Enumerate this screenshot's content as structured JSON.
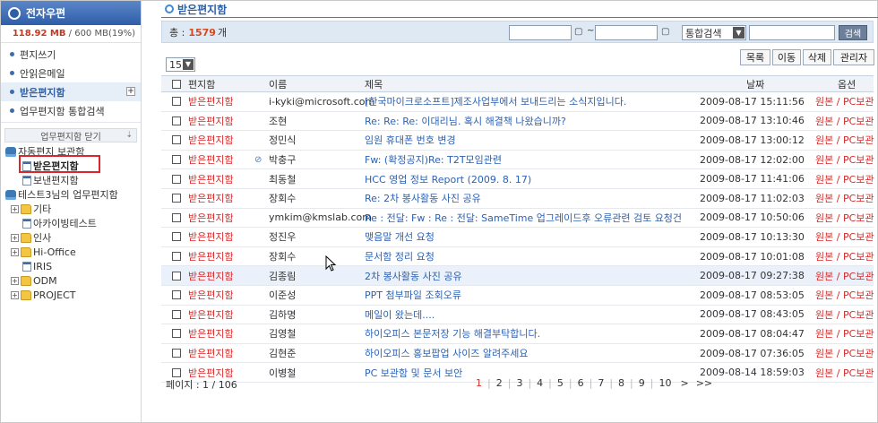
{
  "sidebar": {
    "title": "전자우편",
    "quota": {
      "used": "118.92 MB",
      "total": "/ 600 MB(19%)"
    },
    "menu": [
      {
        "label": "편지쓰기"
      },
      {
        "label": "안읽은메일"
      },
      {
        "label": "받은편지함",
        "plus": "+"
      },
      {
        "label": "업무편지함 통합검색"
      }
    ],
    "close_label": "업무편지함 닫기",
    "tree": {
      "g1": "자동편지 보관함",
      "g1_items": [
        "받은편지함",
        "보낸편지함"
      ],
      "g2": "테스트3님의 업무편지함",
      "g2_items": [
        "기타",
        "아카이빙테스트",
        "인사",
        "Hi-Office",
        "IRIS",
        "ODM",
        "PROJECT"
      ]
    }
  },
  "main": {
    "title": "받은편지함",
    "total_label": "총 :",
    "total_count": "1579",
    "total_unit": "개",
    "date_sep": "~",
    "search_type": "통합검색",
    "search_btn": "검색",
    "per_page": "15",
    "actions": [
      "목록",
      "이동",
      "삭제",
      "관리자"
    ],
    "columns": {
      "box": "편지함",
      "name": "이름",
      "subject": "제목",
      "date": "날짜",
      "option": "옵션"
    },
    "rows": [
      {
        "box": "받은편지함",
        "name": "i-kyki@microsoft.com",
        "subject": "[한국마이크로소프트]제조사업부에서 보내드리는 소식지입니다.",
        "date": "2009-08-17 15:11:56",
        "opt": "원본 / PC보관"
      },
      {
        "box": "받은편지함",
        "name": "조현",
        "subject": "Re: Re: Re: 이대리님. 혹시 해결책 나왔습니까?",
        "date": "2009-08-17 13:10:46",
        "opt": "원본 / PC보관"
      },
      {
        "box": "받은편지함",
        "name": "정민식",
        "subject": "임원 휴대폰 번호 변경",
        "date": "2009-08-17 13:00:12",
        "opt": "원본 / PC보관"
      },
      {
        "box": "받은편지함",
        "name": "박충구",
        "subject": "Fw: (확정공지)Re: T2T모임관련",
        "date": "2009-08-17 12:02:00",
        "opt": "원본 / PC보관",
        "clip": true
      },
      {
        "box": "받은편지함",
        "name": "최동철",
        "subject": "HCC 영업 정보 Report (2009. 8. 17)",
        "date": "2009-08-17 11:41:06",
        "opt": "원본 / PC보관"
      },
      {
        "box": "받은편지함",
        "name": "장회수",
        "subject": "Re: 2차 봉사활동 사진 공유",
        "date": "2009-08-17 11:02:03",
        "opt": "원본 / PC보관"
      },
      {
        "box": "받은편지함",
        "name": "ymkim@kmslab.com",
        "subject": "Re : 전달: Fw : Re : 전달: SameTime 업그레이드후 오류관련 검토 요청건",
        "date": "2009-08-17 10:50:06",
        "opt": "원본 / PC보관"
      },
      {
        "box": "받은편지함",
        "name": "정진우",
        "subject": "맺음말 개선 요청",
        "date": "2009-08-17 10:13:30",
        "opt": "원본 / PC보관"
      },
      {
        "box": "받은편지함",
        "name": "장회수",
        "subject": "문서함 정리 요청",
        "date": "2009-08-17 10:01:08",
        "opt": "원본 / PC보관"
      },
      {
        "box": "받은편지함",
        "name": "김종림",
        "subject": "2차 봉사활동 사진 공유",
        "date": "2009-08-17 09:27:38",
        "opt": "원본 / PC보관",
        "hl": true
      },
      {
        "box": "받은편지함",
        "name": "이준성",
        "subject": "PPT 첨부파일 조회오류",
        "date": "2009-08-17 08:53:05",
        "opt": "원본 / PC보관"
      },
      {
        "box": "받은편지함",
        "name": "김하명",
        "subject": "메일이 왔는데....",
        "date": "2009-08-17 08:43:05",
        "opt": "원본 / PC보관"
      },
      {
        "box": "받은편지함",
        "name": "김영철",
        "subject": "하이오피스 본문저장 기능 해결부탁합니다.",
        "date": "2009-08-17 08:04:47",
        "opt": "원본 / PC보관"
      },
      {
        "box": "받은편지함",
        "name": "김현준",
        "subject": "하이오피스 홍보팝업 사이즈 알려주세요",
        "date": "2009-08-17 07:36:05",
        "opt": "원본 / PC보관"
      },
      {
        "box": "받은편지함",
        "name": "이병철",
        "subject": "PC 보관함 및 문서 보안",
        "date": "2009-08-14 18:59:03",
        "opt": "원본 / PC보관"
      }
    ],
    "page_info": "페이지 : 1 / 106",
    "pages": [
      "1",
      "2",
      "3",
      "4",
      "5",
      "6",
      "7",
      "8",
      "9",
      "10"
    ],
    "next": ">",
    "last": ">>"
  }
}
